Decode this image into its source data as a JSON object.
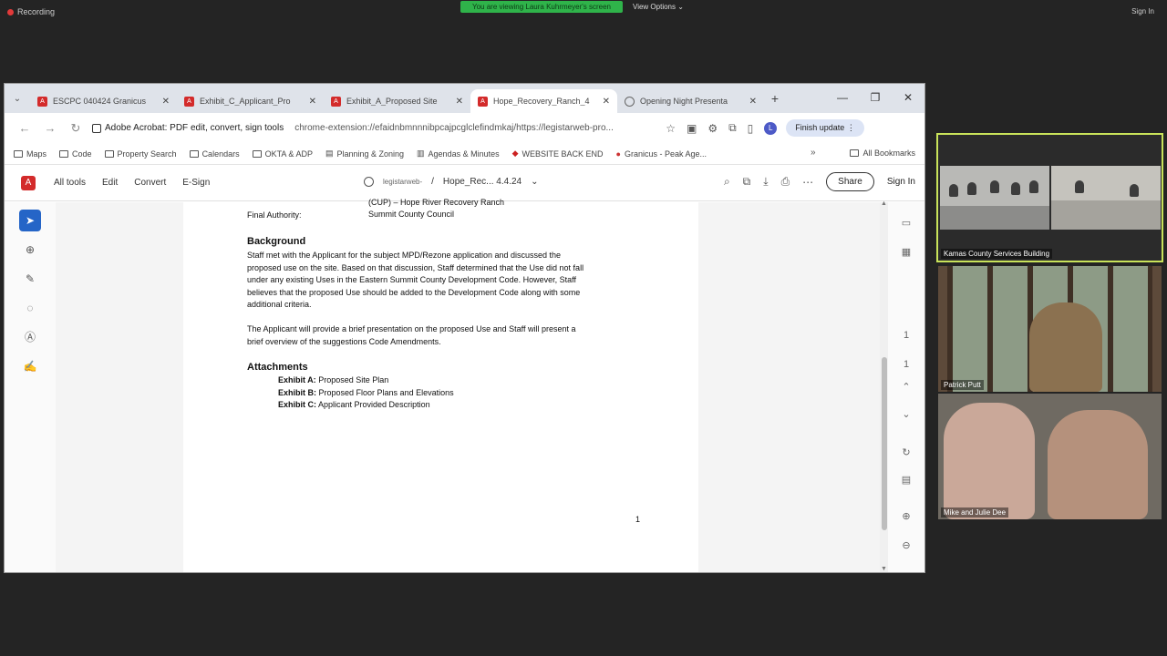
{
  "zoom": {
    "recording": "Recording",
    "viewing_banner": "You are viewing Laura Kuhrmeyer's screen",
    "view_options": "View Options",
    "sign_in": "Sign In"
  },
  "browser": {
    "tabs": [
      {
        "label": "ESCPC 040424 Granicus",
        "icon": "pdf-icon"
      },
      {
        "label": "Exhibit_C_Applicant_Pro",
        "icon": "pdf-icon"
      },
      {
        "label": "Exhibit_A_Proposed Site",
        "icon": "pdf-icon"
      },
      {
        "label": "Hope_Recovery_Ranch_4",
        "icon": "pdf-icon"
      },
      {
        "label": "Opening Night Presenta",
        "icon": "globe-icon"
      }
    ],
    "site_chip": "Adobe Acrobat: PDF edit, convert, sign tools",
    "url": "chrome-extension://efaidnbmnnnibpcajpcglclefindmkaj/https://legistarweb-pro...",
    "finish_update": "Finish update",
    "avatar_letter": "L",
    "bookmarks": [
      "Maps",
      "Code",
      "Property Search",
      "Calendars",
      "OKTA & ADP",
      "Planning & Zoning",
      "Agendas & Minutes",
      "WEBSITE BACK END",
      "Granicus - Peak Age..."
    ],
    "all_bookmarks": "All Bookmarks"
  },
  "acrobat": {
    "menu": [
      "All tools",
      "Edit",
      "Convert",
      "E-Sign"
    ],
    "doc_source": "legistarweb-",
    "doc_sep": "/",
    "doc_name": "Hope_Rec... 4.4.24",
    "share": "Share",
    "sign_in": "Sign In",
    "page_indicator_top": "1",
    "page_indicator_bottom": "1"
  },
  "document": {
    "cup_line": "(CUP) – Hope River Recovery Ranch",
    "final_authority_label": "Final Authority:",
    "final_authority_value": "Summit County Council",
    "background_heading": "Background",
    "background_lines": [
      "Staff met with the Applicant for the subject MPD/Rezone application and discussed the",
      "proposed use on the site. Based on that discussion, Staff determined that the Use did not fall",
      "under any existing Uses in the Eastern Summit County Development Code. However, Staff",
      "believes that the proposed Use should be added to the Development Code along with some",
      "additional criteria."
    ],
    "presentation_lines": [
      "The Applicant will provide a brief presentation on the proposed Use and Staff will present a",
      "brief overview of the suggestions Code Amendments."
    ],
    "attachments_heading": "Attachments",
    "attachments": [
      {
        "label": "Exhibit A:",
        "text": "Proposed Site Plan"
      },
      {
        "label": "Exhibit B:",
        "text": "Proposed Floor Plans and Elevations"
      },
      {
        "label": "Exhibit C:",
        "text": "Applicant Provided Description"
      }
    ],
    "page_number": "1"
  },
  "participants": [
    {
      "name": "Kamas County Services Building"
    },
    {
      "name": "Patrick Putt"
    },
    {
      "name": "Mike and Julie Dee"
    }
  ]
}
